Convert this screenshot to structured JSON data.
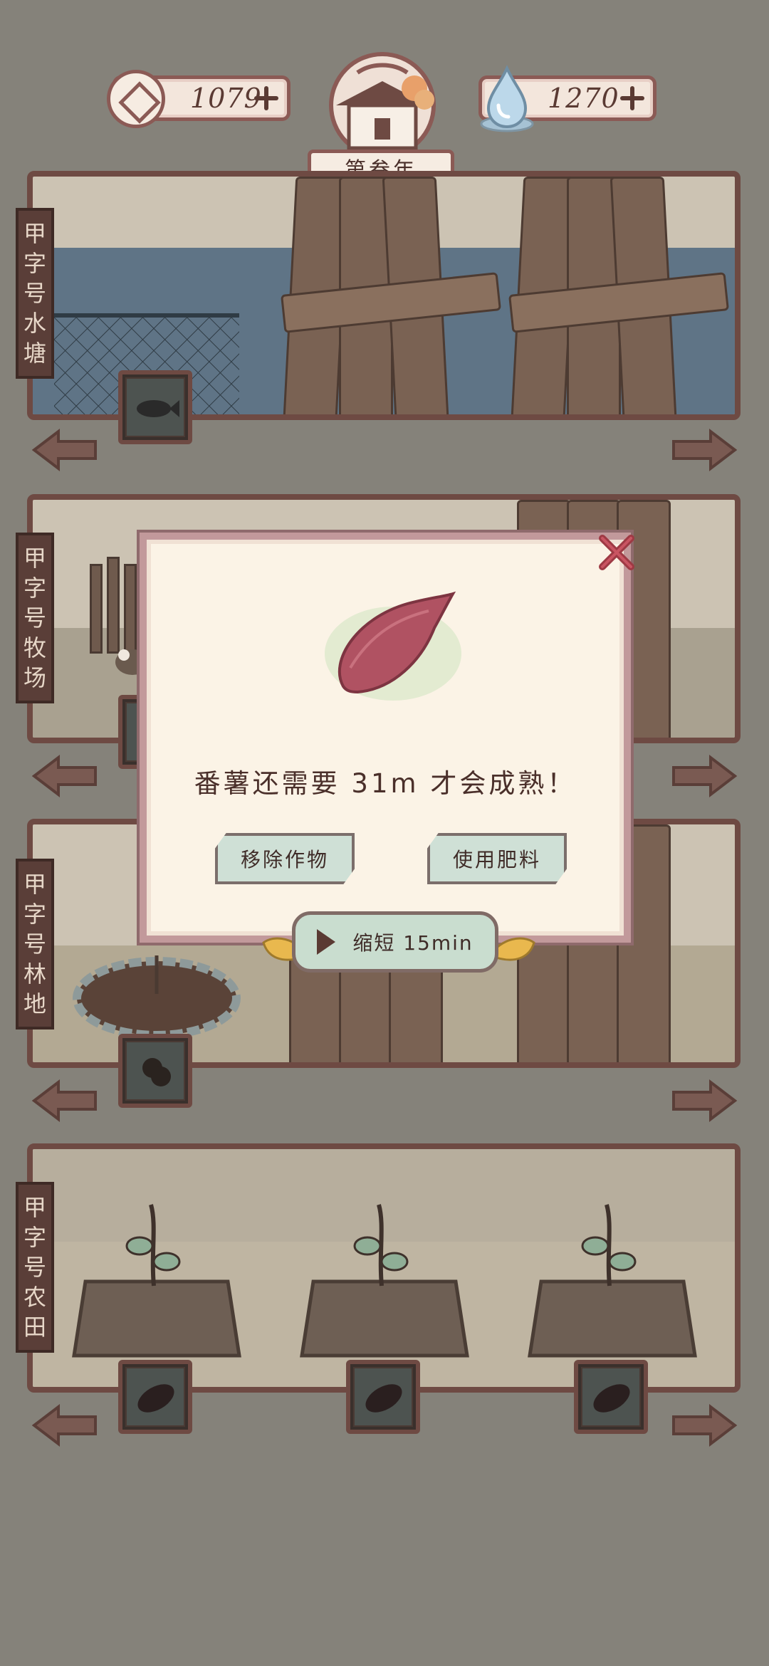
{
  "resources": {
    "coins": "1079",
    "water": "1270"
  },
  "year_label": "第叁年",
  "plots": [
    {
      "label": [
        "甲",
        "字",
        "号",
        "水",
        "塘"
      ]
    },
    {
      "label": [
        "甲",
        "字",
        "号",
        "牧",
        "场"
      ]
    },
    {
      "label": [
        "甲",
        "字",
        "号",
        "林",
        "地"
      ]
    },
    {
      "label": [
        "甲",
        "字",
        "号",
        "农",
        "田"
      ]
    }
  ],
  "dialog": {
    "message": "番薯还需要 31m 才会成熟！",
    "remove_label": "移除作物",
    "fertilize_label": "使用肥料",
    "speedup_label": "缩短 15min"
  },
  "icons": {
    "coin": "coin-icon",
    "water": "water-drop-icon",
    "close": "close-icon",
    "arrow_left": "arrow-left-icon",
    "arrow_right": "arrow-right-icon"
  },
  "colors": {
    "background": "#85827a",
    "panel_border": "#6e4a43",
    "dialog_bg": "#fbf3e6",
    "button_green": "#cfe0d6",
    "sweet_potato": "#b05262"
  }
}
